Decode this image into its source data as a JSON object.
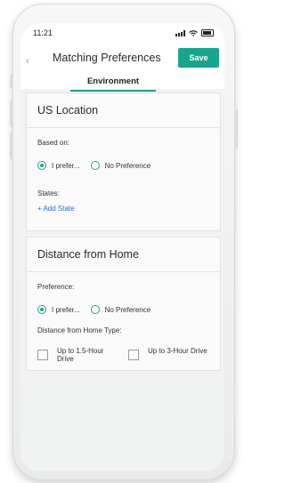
{
  "status": {
    "time": "11:21"
  },
  "header": {
    "title": "Matching Preferences",
    "save_label": "Save",
    "tab": "Environment"
  },
  "location": {
    "title": "US Location",
    "based_on_label": "Based on:",
    "options": [
      "I prefer...",
      "No Preference"
    ],
    "states_label": "States:",
    "add_state": "+ Add State"
  },
  "distance": {
    "title": "Distance from Home",
    "preference_label": "Preference:",
    "options": [
      "I prefer...",
      "No Preference"
    ],
    "type_label": "Distance from Home Type:",
    "types": [
      "Up to 1.5-Hour Drive",
      "Up to 3-Hour Drive"
    ]
  },
  "colors": {
    "accent": "#1aa48d",
    "link": "#2d6bd6"
  }
}
